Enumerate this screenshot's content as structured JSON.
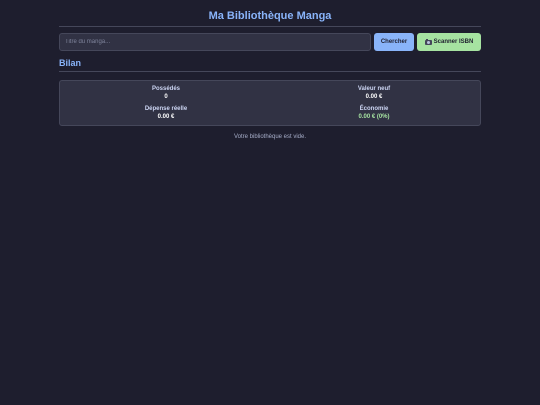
{
  "app": {
    "title": "Ma Bibliothèque Manga"
  },
  "search": {
    "placeholder": "Titre du manga...",
    "value": "",
    "search_label": "Chercher",
    "scan_label": "Scanner ISBN",
    "scan_icon": "camera-icon"
  },
  "summary": {
    "title": "Bilan",
    "owned_label": "Possédés",
    "owned_value": "0",
    "new_value_label": "Valeur neuf",
    "new_value_value": "0.00 €",
    "real_spend_label": "Dépense réelle",
    "real_spend_value": "0.00 €",
    "savings_label": "Économie",
    "savings_value": "0.00 € (0%)"
  },
  "library": {
    "empty_message": "Votre bibliothèque est vide."
  },
  "colors": {
    "background": "#1e1e2e",
    "surface": "#313244",
    "accent_blue": "#89b4fa",
    "accent_green": "#a6e3a1"
  }
}
